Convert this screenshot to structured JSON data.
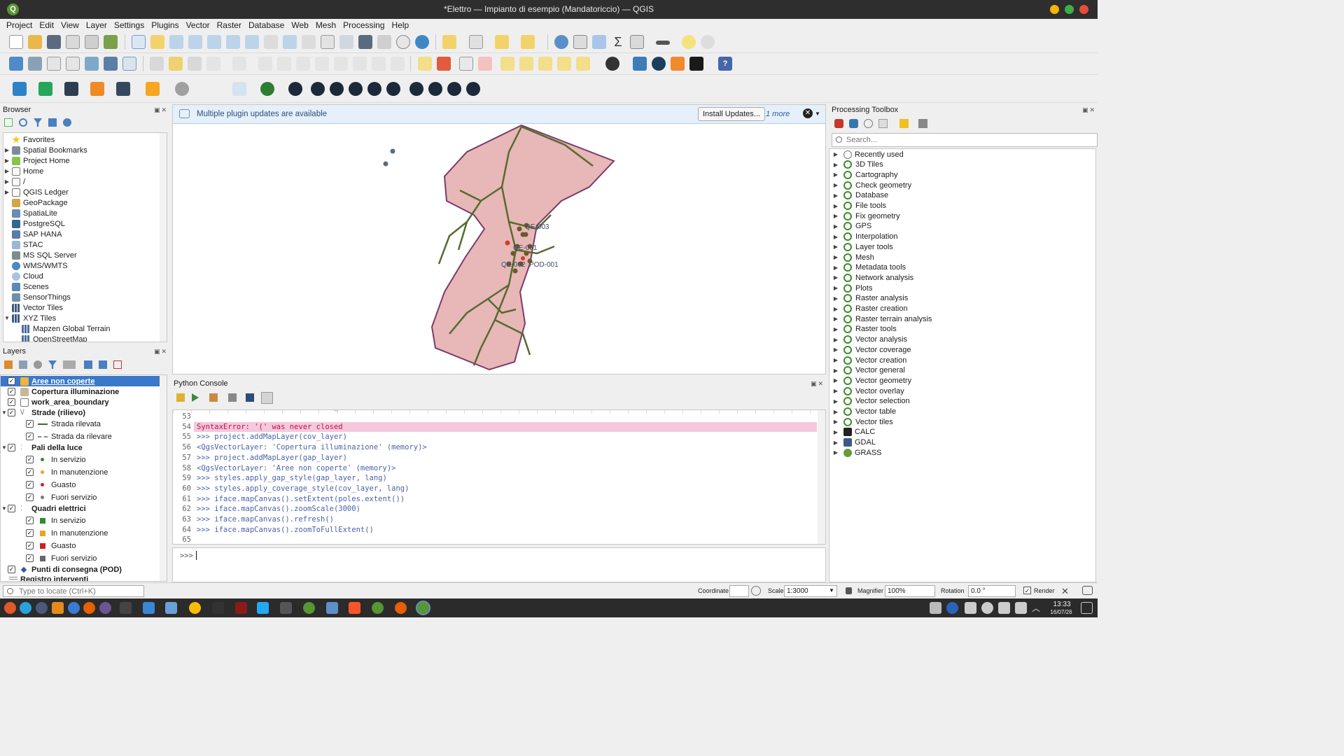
{
  "window": {
    "title": "*Elettro — Impianto di esempio (Mandatoriccio) — QGIS",
    "logo": "Q"
  },
  "menu": [
    "Project",
    "Edit",
    "View",
    "Layer",
    "Settings",
    "Plugins",
    "Vector",
    "Raster",
    "Database",
    "Web",
    "Mesh",
    "Processing",
    "Help"
  ],
  "browser": {
    "title": "Browser",
    "items": [
      {
        "label": "Favorites",
        "icon": "star-icon"
      },
      {
        "label": "Spatial Bookmarks",
        "icon": "bookmark-icon"
      },
      {
        "label": "Project Home",
        "icon": "folder-icon"
      },
      {
        "label": "Home",
        "icon": "folder-icon"
      },
      {
        "label": "/",
        "icon": "folder-icon"
      },
      {
        "label": "QGIS Ledger",
        "icon": "folder-icon"
      },
      {
        "label": "GeoPackage",
        "icon": "geopackage-icon"
      },
      {
        "label": "SpatiaLite",
        "icon": "feather-icon"
      },
      {
        "label": "PostgreSQL",
        "icon": "elephant-icon"
      },
      {
        "label": "SAP HANA",
        "icon": "database-icon"
      },
      {
        "label": "STAC",
        "icon": "stac-icon"
      },
      {
        "label": "MS SQL Server",
        "icon": "database-icon"
      },
      {
        "label": "WMS/WMTS",
        "icon": "globe-icon"
      },
      {
        "label": "Cloud",
        "icon": "cloud-icon"
      },
      {
        "label": "Scenes",
        "icon": "layers-icon"
      },
      {
        "label": "SensorThings",
        "icon": "sensor-icon"
      },
      {
        "label": "Vector Tiles",
        "icon": "grid-icon"
      },
      {
        "label": "XYZ Tiles",
        "icon": "grid-icon"
      },
      {
        "label": "Mapzen Global Terrain",
        "icon": "grid-icon"
      },
      {
        "label": "OpenStreetMap",
        "icon": "grid-icon"
      }
    ]
  },
  "layers": {
    "title": "Layers",
    "items": [
      {
        "label": "Aree non coperte",
        "checked": true,
        "bold": true,
        "selected": true,
        "swatch": "#f4b13c"
      },
      {
        "label": "Copertura illuminazione",
        "checked": true,
        "bold": true,
        "swatch": "#c8b89a"
      },
      {
        "label": "work_area_boundary",
        "checked": true,
        "bold": true,
        "swatch": "#ffffff"
      },
      {
        "label": "Strade (rilievo)",
        "checked": true,
        "bold": true,
        "group": true
      },
      {
        "label": "Strada rilevata",
        "checked": true,
        "child": true,
        "line": "solid",
        "color": "#3a6b32"
      },
      {
        "label": "Strada da rilevare",
        "checked": true,
        "child": true,
        "line": "dashed",
        "color": "#888888"
      },
      {
        "label": "Pali della luce",
        "checked": true,
        "bold": true,
        "group": true
      },
      {
        "label": "In servizio",
        "checked": true,
        "child": true,
        "dot": "#2e8b2e"
      },
      {
        "label": "In manutenzione",
        "checked": true,
        "child": true,
        "dot": "#f0a020"
      },
      {
        "label": "Guasto",
        "checked": true,
        "child": true,
        "dot": "#d02020"
      },
      {
        "label": "Fuori servizio",
        "checked": true,
        "child": true,
        "dot": "#777777"
      },
      {
        "label": "Quadri elettrici",
        "checked": true,
        "bold": true,
        "group": true
      },
      {
        "label": "In servizio",
        "checked": true,
        "child": true,
        "square": "#2e8b2e"
      },
      {
        "label": "In manutenzione",
        "checked": true,
        "child": true,
        "square": "#f0a020"
      },
      {
        "label": "Guasto",
        "checked": true,
        "child": true,
        "square": "#d02020"
      },
      {
        "label": "Fuori servizio",
        "checked": true,
        "child": true,
        "square": "#666666"
      },
      {
        "label": "Punti di consegna (POD)",
        "checked": true,
        "bold": true,
        "dot": "#3355aa"
      },
      {
        "label": "Registro interventi",
        "checked": false,
        "bold": true,
        "table": true
      }
    ]
  },
  "notification": {
    "message": "Multiple plugin updates are available",
    "button": "Install Updates...",
    "more": "1 more"
  },
  "map": {
    "labels": [
      "QE-003",
      "QE-001",
      "QE-002",
      "POD-001"
    ]
  },
  "console": {
    "title": "Python Console",
    "lines": [
      {
        "n": "53",
        "text": "",
        "type": "plain"
      },
      {
        "n": "54",
        "text": "SyntaxError: '(' was never closed",
        "type": "error"
      },
      {
        "n": "55",
        "text": ">>> project.addMapLayer(cov_layer)",
        "type": "prompt"
      },
      {
        "n": "56",
        "text": "<QgsVectorLayer: 'Copertura illuminazione' (memory)>",
        "type": "output"
      },
      {
        "n": "57",
        "text": ">>> project.addMapLayer(gap_layer)",
        "type": "prompt"
      },
      {
        "n": "58",
        "text": "<QgsVectorLayer: 'Aree non coperte' (memory)>",
        "type": "output"
      },
      {
        "n": "59",
        "text": ">>> styles.apply_gap_style(gap_layer, lang)",
        "type": "prompt"
      },
      {
        "n": "60",
        "text": ">>> styles.apply_coverage_style(cov_layer, lang)",
        "type": "prompt"
      },
      {
        "n": "61",
        "text": ">>> iface.mapCanvas().setExtent(poles.extent())",
        "type": "prompt"
      },
      {
        "n": "62",
        "text": ">>> iface.mapCanvas().zoomScale(3000)",
        "type": "prompt"
      },
      {
        "n": "63",
        "text": ">>> iface.mapCanvas().refresh()",
        "type": "prompt"
      },
      {
        "n": "64",
        "text": ">>> iface.mapCanvas().zoomToFullExtent()",
        "type": "prompt"
      },
      {
        "n": "65",
        "text": "",
        "type": "plain"
      }
    ],
    "input_prompt": ">>>"
  },
  "processing": {
    "title": "Processing Toolbox",
    "search_placeholder": "Search...",
    "items": [
      "Recently used",
      "3D Tiles",
      "Cartography",
      "Check geometry",
      "Database",
      "File tools",
      "Fix geometry",
      "GPS",
      "Interpolation",
      "Layer tools",
      "Mesh",
      "Metadata tools",
      "Network analysis",
      "Plots",
      "Raster analysis",
      "Raster creation",
      "Raster terrain analysis",
      "Raster tools",
      "Vector analysis",
      "Vector coverage",
      "Vector creation",
      "Vector general",
      "Vector geometry",
      "Vector overlay",
      "Vector selection",
      "Vector table",
      "Vector tiles",
      "CALC",
      "GDAL",
      "GRASS"
    ]
  },
  "status": {
    "locate_placeholder": "Type to locate (Ctrl+K)",
    "coordinate_label": "Coordinate",
    "coordinate_value": "",
    "scale_label": "Scale",
    "scale_value": "1:3000",
    "magnifier_label": "Magnifier",
    "magnifier_value": "100%",
    "rotation_label": "Rotation",
    "rotation_value": "0.0 °",
    "render_label": "Render"
  },
  "taskbar": {
    "time": "13:33",
    "date": "16/07/26"
  },
  "colors": {
    "accent": "#3a78c9",
    "area_fill": "#e8b7b7",
    "area_stroke": "#7a3a6a",
    "road": "#556b2f"
  }
}
